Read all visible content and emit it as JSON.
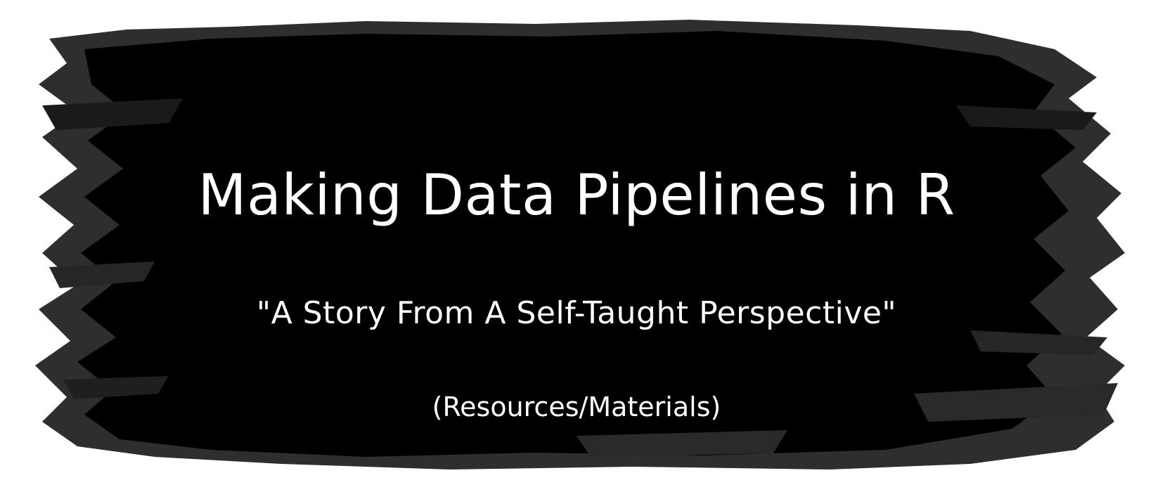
{
  "banner": {
    "title": "Making Data Pipelines in R",
    "subtitle": "\"A Story From A Self-Taught Perspective\"",
    "note": "(Resources/Materials)"
  },
  "colors": {
    "background": "#ffffff",
    "brush_dark": "#000000",
    "brush_mid": "#2e2e2e",
    "brush_edge": "#3a3a3a",
    "text": "#ffffff"
  }
}
